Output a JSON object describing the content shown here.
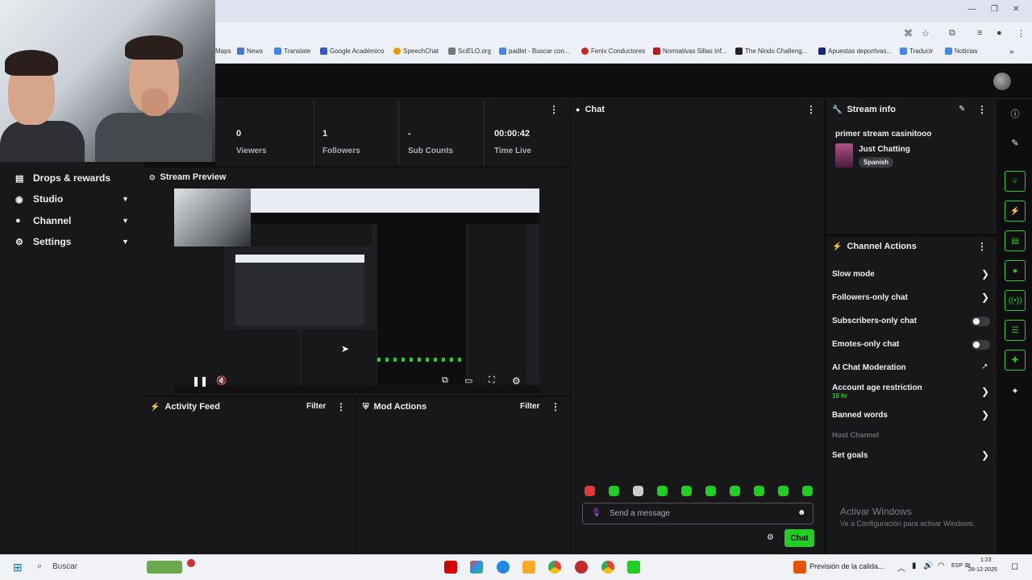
{
  "browser": {
    "bookmarks": [
      "Maps",
      "News",
      "Translate",
      "Google Académico",
      "SpeechChat",
      "SciELO.org",
      "padlet - Buscar con...",
      "Fenix Conductores",
      "Normativas Sillas Inf...",
      "The Nindo Challeng...",
      "Apuestas deportivas...",
      "Traducir",
      "Noticias"
    ],
    "bookmark_colors": [
      "#4285f4",
      "#4a76d8",
      "#4285f4",
      "#2a5ad6",
      "#f29a00",
      "#333333",
      "#4285f4",
      "#c62828",
      "#b71c1c",
      "#222222",
      "#1a237e",
      "#4285f4",
      "#4285f4"
    ]
  },
  "stats": [
    {
      "value": "0",
      "label": "Viewers"
    },
    {
      "value": "1",
      "label": "Followers"
    },
    {
      "value": "-",
      "label": "Sub Counts"
    },
    {
      "value": "00:00:42",
      "label": "Time Live"
    }
  ],
  "nav": [
    {
      "label": "Drops & rewards",
      "icon": "gift-icon",
      "chevron": false
    },
    {
      "label": "Studio",
      "icon": "camera-icon",
      "chevron": true
    },
    {
      "label": "Channel",
      "icon": "user-icon",
      "chevron": true
    },
    {
      "label": "Settings",
      "icon": "gear-icon",
      "chevron": true
    }
  ],
  "preview": {
    "title": "Stream Preview"
  },
  "activity": {
    "title": "Activity Feed",
    "filter": "Filter"
  },
  "mod": {
    "title": "Mod Actions",
    "filter": "Filter"
  },
  "chat": {
    "title": "Chat",
    "placeholder": "Send a message",
    "send_label": "Chat",
    "emote_colors": [
      "#e53935",
      "#1fd020",
      "#cccccc",
      "#1fd020",
      "#1fd020",
      "#1fd020",
      "#1fd020",
      "#1fd020",
      "#1fd020",
      "#1fd020"
    ]
  },
  "stream_info": {
    "title": "Stream info",
    "stream_title": "primer stream casinitooo",
    "category": "Just Chatting",
    "language": "Spanish"
  },
  "channel_actions": {
    "title": "Channel Actions",
    "items": [
      {
        "label": "Slow mode",
        "control": "chevron"
      },
      {
        "label": "Followers-only chat",
        "control": "chevron"
      },
      {
        "label": "Subscribers-only chat",
        "control": "toggle-off"
      },
      {
        "label": "Emotes-only chat",
        "control": "toggle-off"
      },
      {
        "label": "AI Chat Moderation",
        "control": "external"
      },
      {
        "label": "Account age restriction",
        "sub": "18 hr",
        "control": "chevron"
      },
      {
        "label": "Banned words",
        "control": "chevron"
      },
      {
        "label": "Host Channel",
        "control": "none",
        "disabled": true
      },
      {
        "label": "Set goals",
        "control": "chevron"
      }
    ]
  },
  "watermark": {
    "line1": "Activar Windows",
    "line2": "Ve a Configuración para activar Windows."
  },
  "taskbar": {
    "search": "Buscar",
    "news": "Previsión de la calida...",
    "lang": "ESP",
    "time": "1:23",
    "date": "28-12-2025"
  },
  "colors": {
    "accent": "#1fd020",
    "panel": "#18181b",
    "bg": "#0e0e10"
  }
}
